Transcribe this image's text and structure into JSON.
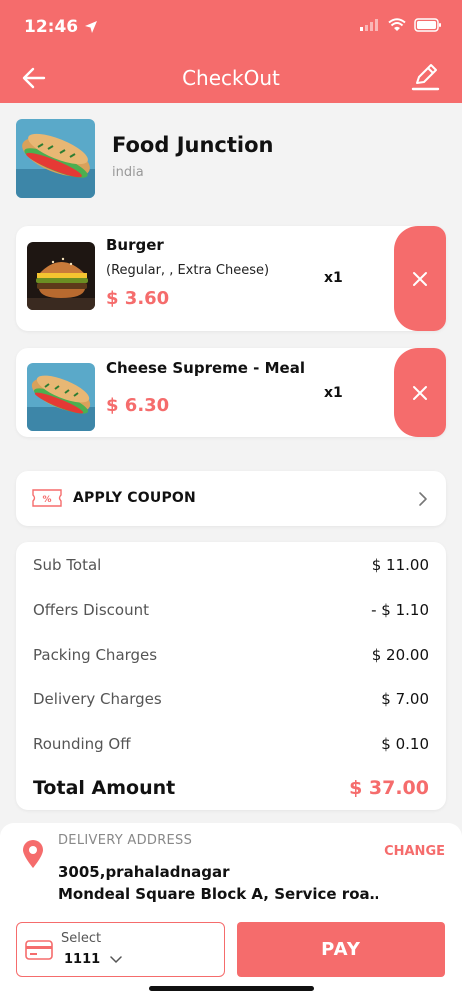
{
  "status_bar": {
    "time": "12:46"
  },
  "header": {
    "title": "CheckOut"
  },
  "restaurant": {
    "name": "Food Junction",
    "location": "india"
  },
  "cart_items": [
    {
      "name": "Burger",
      "variant": "(Regular, , Extra Cheese)",
      "price": "$ 3.60",
      "qty": "x1"
    },
    {
      "name": "Cheese Supreme -  Meal",
      "price": "$ 6.30",
      "qty": "x1"
    }
  ],
  "coupon": {
    "label": "APPLY COUPON"
  },
  "summary": {
    "rows": [
      {
        "label": "Sub Total",
        "value": "$ 11.00"
      },
      {
        "label": "Offers Discount",
        "value": "- $ 1.10"
      },
      {
        "label": "Packing Charges",
        "value": "$ 20.00"
      },
      {
        "label": "Delivery Charges",
        "value": "$ 7.00"
      },
      {
        "label": "Rounding Off",
        "value": "$ 0.10"
      }
    ],
    "total_label": "Total Amount",
    "total_value": "$ 37.00"
  },
  "delivery": {
    "heading": "DELIVERY ADDRESS",
    "change_label": "CHANGE",
    "line1": "3005,prahaladnagar",
    "line2": "Mondeal Square Block A, Service roa…"
  },
  "payment": {
    "select_label": "Select",
    "card_value": "1111",
    "pay_label": "PAY"
  },
  "colors": {
    "accent": "#f56c6c",
    "background": "#f3f3f3"
  }
}
